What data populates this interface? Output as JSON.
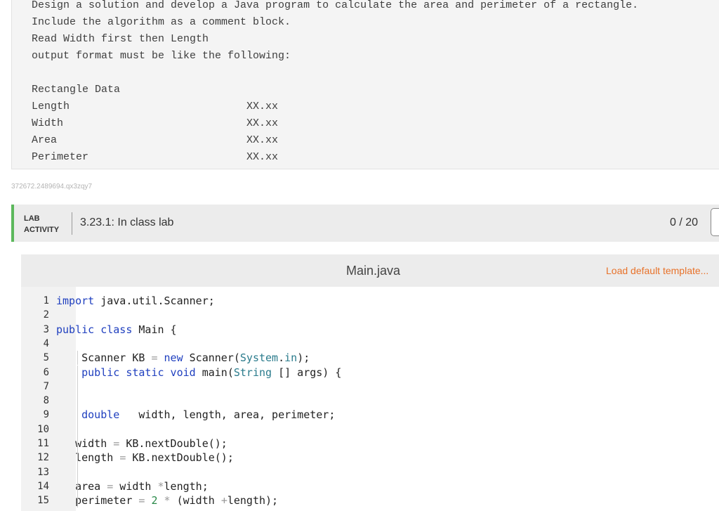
{
  "problem": {
    "lines": [
      "Design a solution and develop a Java program to calculate the area and perimeter of a rectangle.",
      "Include the algorithm as a comment block.",
      "Read Width first then Length",
      "output format must be like the following:"
    ],
    "table_title": "Rectangle Data",
    "rows": [
      {
        "label": "Length",
        "value": "XX.xx"
      },
      {
        "label": "Width",
        "value": "XX.xx"
      },
      {
        "label": "Area",
        "value": "XX.xx"
      },
      {
        "label": "Perimeter",
        "value": "XX.xx"
      }
    ]
  },
  "watermark": "372672.2489694.qx3zqy7",
  "lab": {
    "tag_line1": "LAB",
    "tag_line2": "ACTIVITY",
    "title": "3.23.1: In class lab",
    "score": "0 / 20"
  },
  "editor": {
    "file_name": "Main.java",
    "load_template": "Load default template...",
    "lines": [
      {
        "n": "1",
        "tokens": [
          [
            "kw",
            "import"
          ],
          [
            "",
            " java.util.Scanner;"
          ]
        ]
      },
      {
        "n": "2",
        "tokens": []
      },
      {
        "n": "3",
        "tokens": [
          [
            "kw",
            "public class"
          ],
          [
            "",
            " Main {"
          ]
        ]
      },
      {
        "n": "4",
        "tokens": []
      },
      {
        "n": "5",
        "tokens": [
          [
            "",
            "    Scanner KB "
          ],
          [
            "op",
            "="
          ],
          [
            "",
            " "
          ],
          [
            "kw",
            "new"
          ],
          [
            "",
            " Scanner("
          ],
          [
            "ty",
            "System"
          ],
          [
            "",
            "."
          ],
          [
            "ty",
            "in"
          ],
          [
            "",
            ");"
          ]
        ]
      },
      {
        "n": "6",
        "tokens": [
          [
            "",
            "    "
          ],
          [
            "kw",
            "public static void"
          ],
          [
            "",
            " main("
          ],
          [
            "ty",
            "String"
          ],
          [
            "",
            " [] args) {"
          ]
        ]
      },
      {
        "n": "7",
        "tokens": []
      },
      {
        "n": "8",
        "tokens": []
      },
      {
        "n": "9",
        "tokens": [
          [
            "",
            "    "
          ],
          [
            "kw",
            "double"
          ],
          [
            "",
            "   width, length, area, perimeter;"
          ]
        ]
      },
      {
        "n": "10",
        "tokens": []
      },
      {
        "n": "11",
        "tokens": [
          [
            "",
            "   width "
          ],
          [
            "op",
            "="
          ],
          [
            "",
            " KB.nextDouble();"
          ]
        ]
      },
      {
        "n": "12",
        "tokens": [
          [
            "",
            "   length "
          ],
          [
            "op",
            "="
          ],
          [
            "",
            " KB.nextDouble();"
          ]
        ]
      },
      {
        "n": "13",
        "tokens": []
      },
      {
        "n": "14",
        "tokens": [
          [
            "",
            "   area "
          ],
          [
            "op",
            "="
          ],
          [
            "",
            " width "
          ],
          [
            "op",
            "*"
          ],
          [
            "",
            "length;"
          ]
        ]
      },
      {
        "n": "15",
        "tokens": [
          [
            "",
            "   perimeter "
          ],
          [
            "op",
            "="
          ],
          [
            "",
            " "
          ],
          [
            "num",
            "2"
          ],
          [
            "",
            " "
          ],
          [
            "op",
            "*"
          ],
          [
            "",
            " (width "
          ],
          [
            "op",
            "+"
          ],
          [
            "",
            "length);"
          ]
        ]
      }
    ]
  },
  "colors": {
    "accent_green": "#5cb85c",
    "link_orange": "#e8722a",
    "keyword_blue": "#1f3fbf"
  }
}
